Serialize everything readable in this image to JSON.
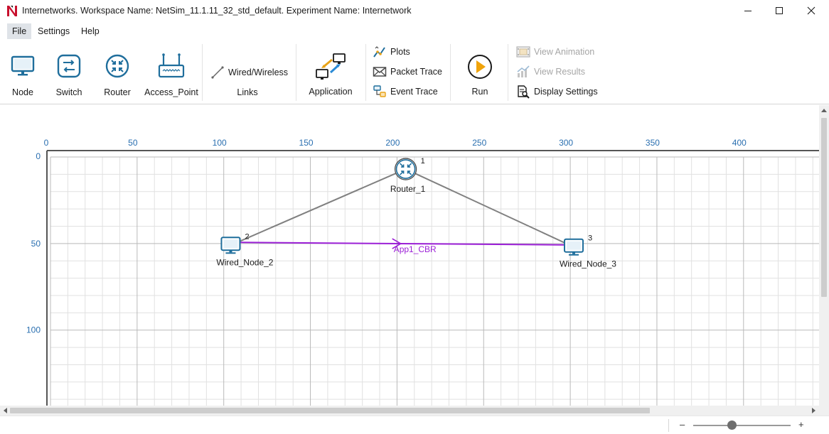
{
  "window": {
    "title": "Internetworks. Workspace Name: NetSim_11.1.11_32_std_default. Experiment Name: Internetwork",
    "controls": [
      "minimize",
      "maximize",
      "close"
    ]
  },
  "menu": {
    "items": [
      "File",
      "Settings",
      "Help"
    ],
    "active": "File"
  },
  "toolbar": {
    "devices": {
      "node": "Node",
      "switch": "Switch",
      "router": "Router",
      "access_point": "Access_Point"
    },
    "links": {
      "button": "Wired/Wireless",
      "group": "Links"
    },
    "application": "Application",
    "traces": {
      "plots": "Plots",
      "packet_trace": "Packet Trace",
      "event_trace": "Event Trace"
    },
    "run": "Run",
    "view": {
      "view_animation": "View Animation",
      "view_results": "View Results",
      "display_settings": "Display Settings"
    }
  },
  "canvas": {
    "x_ticks": [
      "0",
      "50",
      "100",
      "150",
      "200",
      "250",
      "300",
      "350",
      "400"
    ],
    "y_ticks": [
      "0",
      "50",
      "100"
    ],
    "x_tick_values": [
      0,
      50,
      100,
      150,
      200,
      250,
      300,
      350,
      400
    ],
    "y_tick_values": [
      0,
      50,
      100
    ],
    "devices": [
      {
        "id": "1",
        "label": "Router_1",
        "type": "router",
        "x": 205,
        "y": 7
      },
      {
        "id": "2",
        "label": "Wired_Node_2",
        "type": "node",
        "x": 104,
        "y": 51
      },
      {
        "id": "3",
        "label": "Wired_Node_3",
        "type": "node",
        "x": 302,
        "y": 52
      }
    ],
    "links": [
      {
        "from": "1",
        "to": "2"
      },
      {
        "from": "1",
        "to": "3"
      }
    ],
    "applications": [
      {
        "label": "App1_CBR",
        "from": "2",
        "to": "3"
      }
    ],
    "colors": {
      "axis_label": "#2a6fb0",
      "link": "#808080",
      "application": "#9b1fd6",
      "device": "#1f6e9c"
    }
  },
  "statusbar": {
    "zoom_minus": "–",
    "zoom_plus": "+",
    "zoom_level": 0.4
  }
}
